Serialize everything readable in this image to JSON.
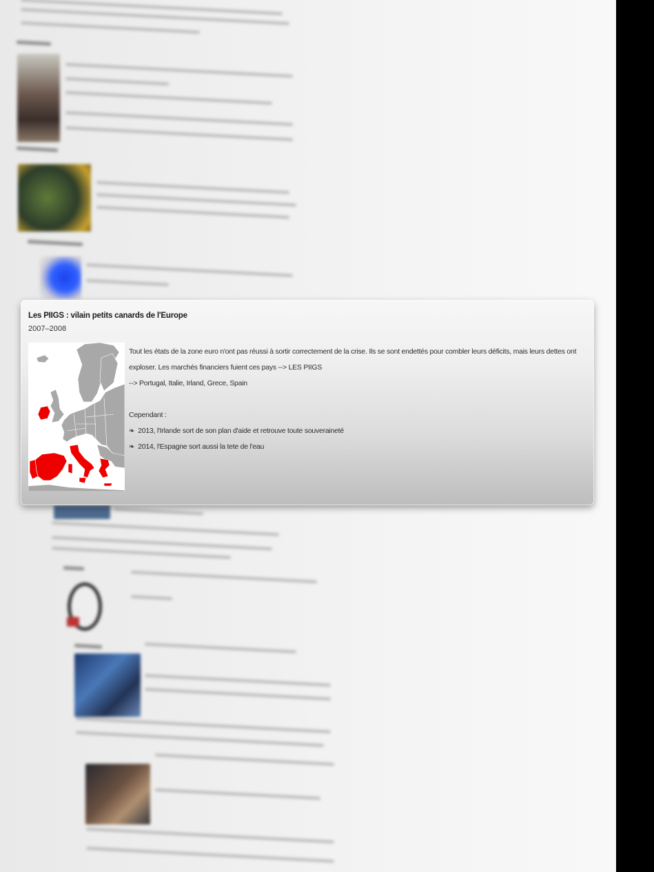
{
  "card": {
    "title": "Les PIIGS : vilain petits canards de l'Europe",
    "date": "2007–2008",
    "paragraph": "Tout les états de la zone euro n'ont pas réussi à sortir correctement de la crise. Ils se sont endettés pour combler leurs déficits, mais leurs dettes ont exploser. Les marchés financiers fuient ces pays --> LES PIIGS",
    "countries_line": "--> Portugal, Italie, Irland, Grece, Spain",
    "however_label": "Cependant :",
    "bullets": [
      "2013, l'Irlande sort de son plan d'aide et retrouve toute souveraineté",
      "2014, l'Espagne sort aussi la tete de l'eau"
    ],
    "bullet_glyph": "❧"
  },
  "map": {
    "base_color": "#a8a8a8",
    "border_color": "#ffffff",
    "highlight_color": "#ee0000",
    "highlighted": [
      "Portugal",
      "Ireland",
      "Italy",
      "Greece",
      "Spain"
    ]
  },
  "colors": {
    "edge_band": "#000000"
  }
}
